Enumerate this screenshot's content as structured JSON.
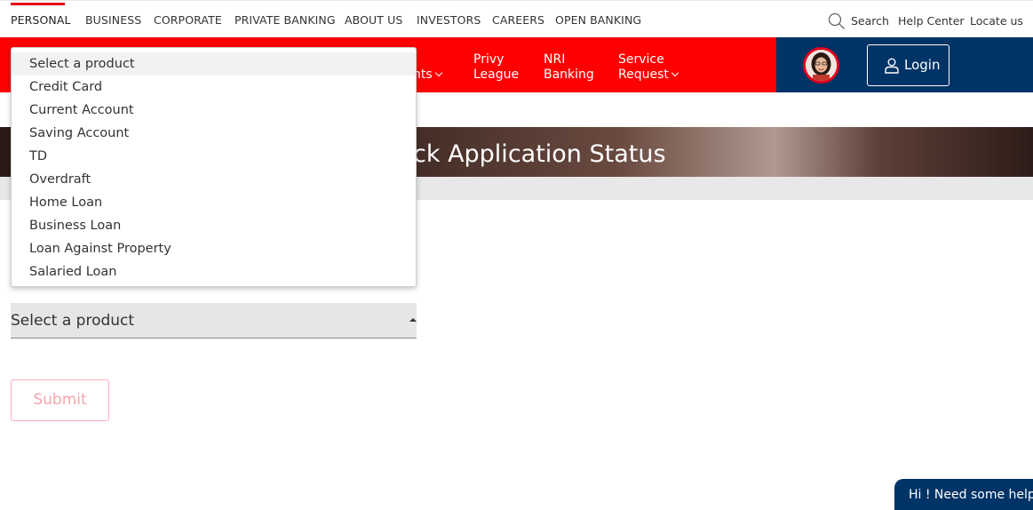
{
  "topnav": {
    "items": [
      "PERSONAL",
      "BUSINESS",
      "CORPORATE",
      "PRIVATE BANKING",
      "ABOUT US",
      "INVESTORS",
      "CAREERS",
      "OPEN BANKING"
    ],
    "search": "Search",
    "help_center": "Help Center",
    "locate_us": "Locate us"
  },
  "mainnav": {
    "partial_item": "nts",
    "privy": [
      "Privy",
      "League"
    ],
    "nri": [
      "NRI",
      "Banking"
    ],
    "service": [
      "Service",
      "Request"
    ],
    "login": "Login"
  },
  "banner": {
    "title": "ck Application Status"
  },
  "form": {
    "selected_value": "Select a product",
    "options": [
      "Select a product",
      "Credit Card",
      "Current Account",
      "Saving Account",
      "TD",
      "Overdraft",
      "Home Loan",
      "Business Loan",
      "Loan Against Property",
      "Salaried Loan"
    ],
    "submit": "Submit"
  },
  "chat": {
    "label": "Hi ! Need some help?"
  },
  "icons": {
    "search": "search-icon",
    "user": "user-icon",
    "avatar": "assistant-avatar",
    "chevron": "chevron-down-icon",
    "caret": "caret-up-icon"
  },
  "colors": {
    "brand_red": "#fe0000",
    "navy": "#003366",
    "accent_red": "#e4001b"
  }
}
